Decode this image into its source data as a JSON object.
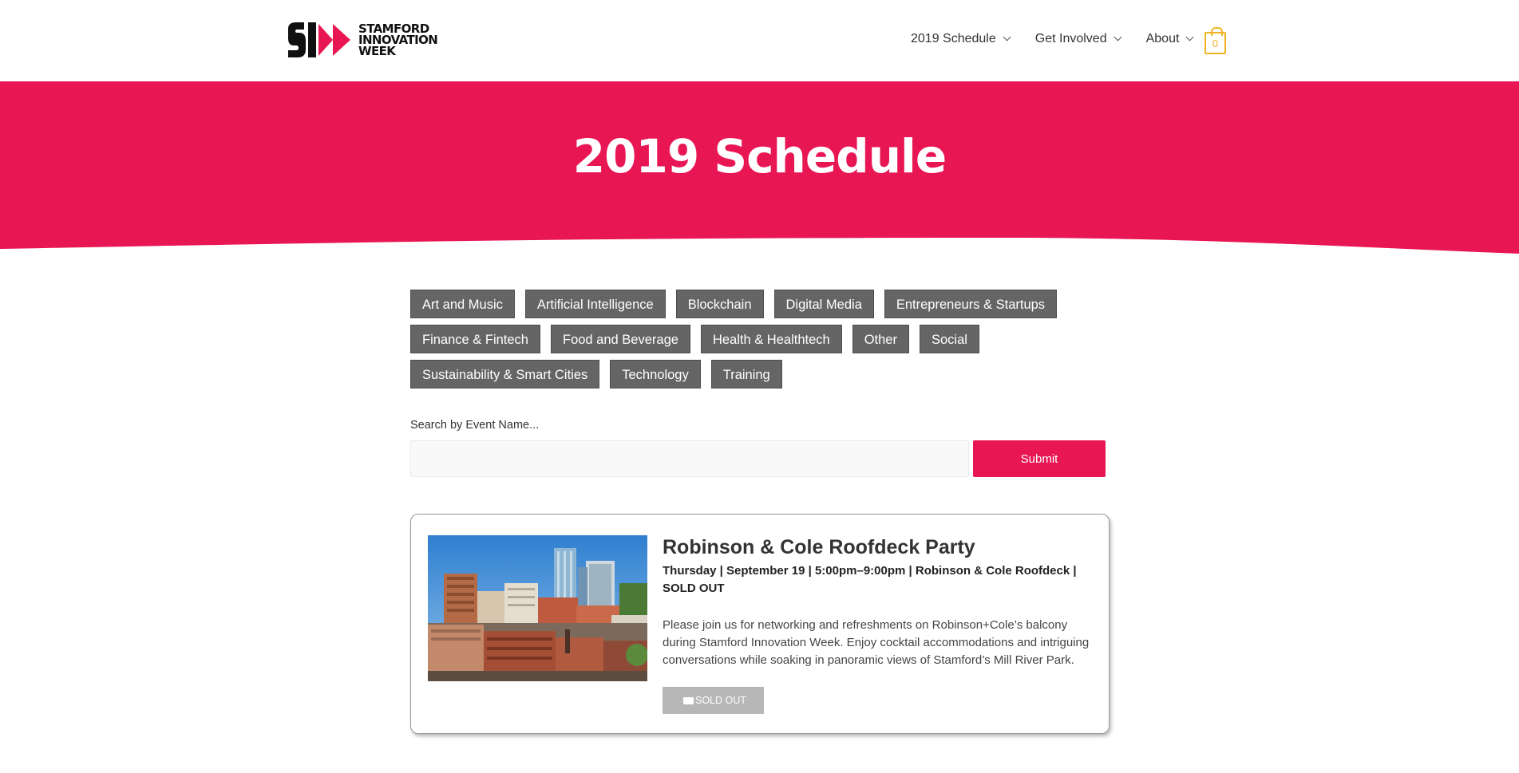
{
  "header": {
    "logo_lines": [
      "STAMFORD",
      "INNOVATION",
      "WEEK"
    ],
    "logo_mark": "SI",
    "nav": [
      {
        "label": "2019 Schedule"
      },
      {
        "label": "Get Involved"
      },
      {
        "label": "About"
      }
    ],
    "cart_count": "0"
  },
  "hero": {
    "title": "2019 Schedule"
  },
  "categories": {
    "rows": [
      [
        "Art and Music",
        "Artificial Intelligence",
        "Blockchain",
        "Digital Media",
        "Entrepreneurs & Startups"
      ],
      [
        "Finance & Fintech",
        "Food and Beverage",
        "Health & Healthtech",
        "Other",
        "Social"
      ],
      [
        "Sustainability & Smart Cities",
        "Technology",
        "Training"
      ]
    ]
  },
  "search": {
    "label": "Search by Event Name...",
    "value": "",
    "placeholder": "",
    "submit_label": "Submit"
  },
  "event": {
    "title": "Robinson & Cole Roofdeck Party",
    "meta": "Thursday | September 19 | 5:00pm–9:00pm | Robinson & Cole Roofdeck | SOLD OUT",
    "description": "Please join us for networking and refreshments on Robinson+Cole’s balcony during Stamford Innovation Week. Enjoy cocktail accommodations and intriguing conversations while soaking in panoramic views of Stamford’s Mill River Park.",
    "button_label": "SOLD OUT",
    "button_icon": "ticket-icon"
  },
  "colors": {
    "brand": "#e91654",
    "cart_accent": "#f0b323",
    "category_bg": "#656565",
    "soldout_bg": "#b7b7b7"
  }
}
